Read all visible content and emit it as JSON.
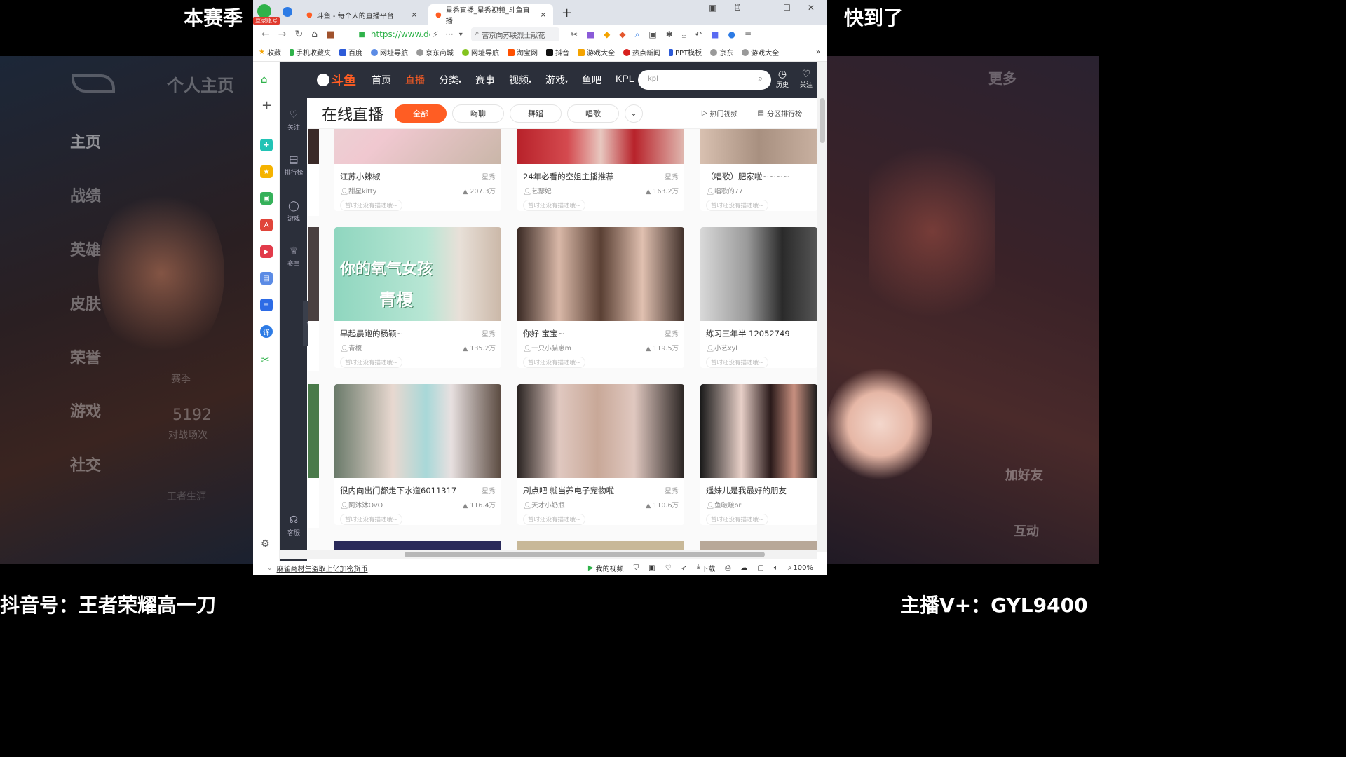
{
  "overlay": {
    "top_left": "本赛季",
    "top_right": "快到了",
    "bottom_left": "抖音号：王者荣耀高一刀",
    "bottom_right": "主播V+：GYL9400"
  },
  "game_bg": {
    "profile_label": "个人主页",
    "menu": [
      "主页",
      "战绩",
      "英雄",
      "皮肤",
      "荣誉",
      "游戏",
      "社交"
    ],
    "season_label": "赛季",
    "match_count": "5192",
    "match_label": "对战场次",
    "career": "王者生涯",
    "more": "更多",
    "add_friend": "加好友",
    "interact": "互动"
  },
  "browser": {
    "login_badge": "登录账号",
    "tabs": [
      {
        "label": "斗鱼 - 每个人的直播平台"
      },
      {
        "label": "星秀直播_星秀视频_斗鱼直播"
      }
    ],
    "url": "https://www.dc",
    "search_hint": "营京向苏联烈士献花",
    "bookmarks": [
      "收藏",
      "手机收藏夹",
      "百度",
      "网址导航",
      "京东商城",
      "网址导航",
      "淘宝网",
      "抖音",
      "游戏大全",
      "热点新闻",
      "PPT模板",
      "京东",
      "游戏大全"
    ],
    "status_left": "麻雀商材生盗取上亿加密货币",
    "status_video": "我的视频",
    "status_download": "下载",
    "zoom": "100%"
  },
  "douyu": {
    "logo": "斗鱼",
    "nav": [
      "首页",
      "直播",
      "分类",
      "赛事",
      "视频",
      "游戏",
      "鱼吧",
      "KPL"
    ],
    "search_value": "kpl",
    "history": "历史",
    "follow": "关注",
    "side": [
      "关注",
      "排行榜",
      "游戏",
      "赛事",
      "客服"
    ],
    "page_title": "在线直播",
    "filters": [
      "全部",
      "嗨聊",
      "舞蹈",
      "唱歌"
    ],
    "hot_video": "热门视频",
    "rank": "分区排行榜",
    "desc_placeholder": "暂时还没有描述哦~",
    "rows": [
      [
        {
          "title": "江苏小辣椒",
          "tag": "星秀",
          "user": "甜星kitty",
          "heat": "207.3万"
        },
        {
          "title": "24年必看的空姐主播推荐",
          "tag": "星秀",
          "user": "艺瑟妃",
          "heat": "163.2万"
        },
        {
          "title": "（唱歌）肥家啦~~~~",
          "tag": "",
          "user": "唱歌的77",
          "heat": ""
        }
      ],
      [
        {
          "title": "早起晨跑的杨颖~",
          "tag": "星秀",
          "user": "青榎",
          "heat": "135.2万",
          "overlay1": "你的氧气女孩",
          "overlay2": "青榎"
        },
        {
          "title": "你好 宝宝~",
          "tag": "星秀",
          "user": "一只小猫崽m",
          "heat": "119.5万"
        },
        {
          "title": "练习三年半 12052749",
          "tag": "",
          "user": "小艺xyl",
          "heat": ""
        }
      ],
      [
        {
          "title": "很内向出门都走下水道6011317",
          "tag": "星秀",
          "user": "阿沐沐OvO",
          "heat": "116.4万"
        },
        {
          "title": "刷点吧 就当养电子宠物啦",
          "tag": "星秀",
          "user": "天才小奶瓶",
          "heat": "110.6万"
        },
        {
          "title": "遥妹儿是我最好的朋友",
          "tag": "",
          "user": "鱼啵啵or",
          "heat": ""
        }
      ]
    ]
  },
  "colors": {
    "accent": "#ff5d23",
    "dark": "#2b2f3a"
  }
}
